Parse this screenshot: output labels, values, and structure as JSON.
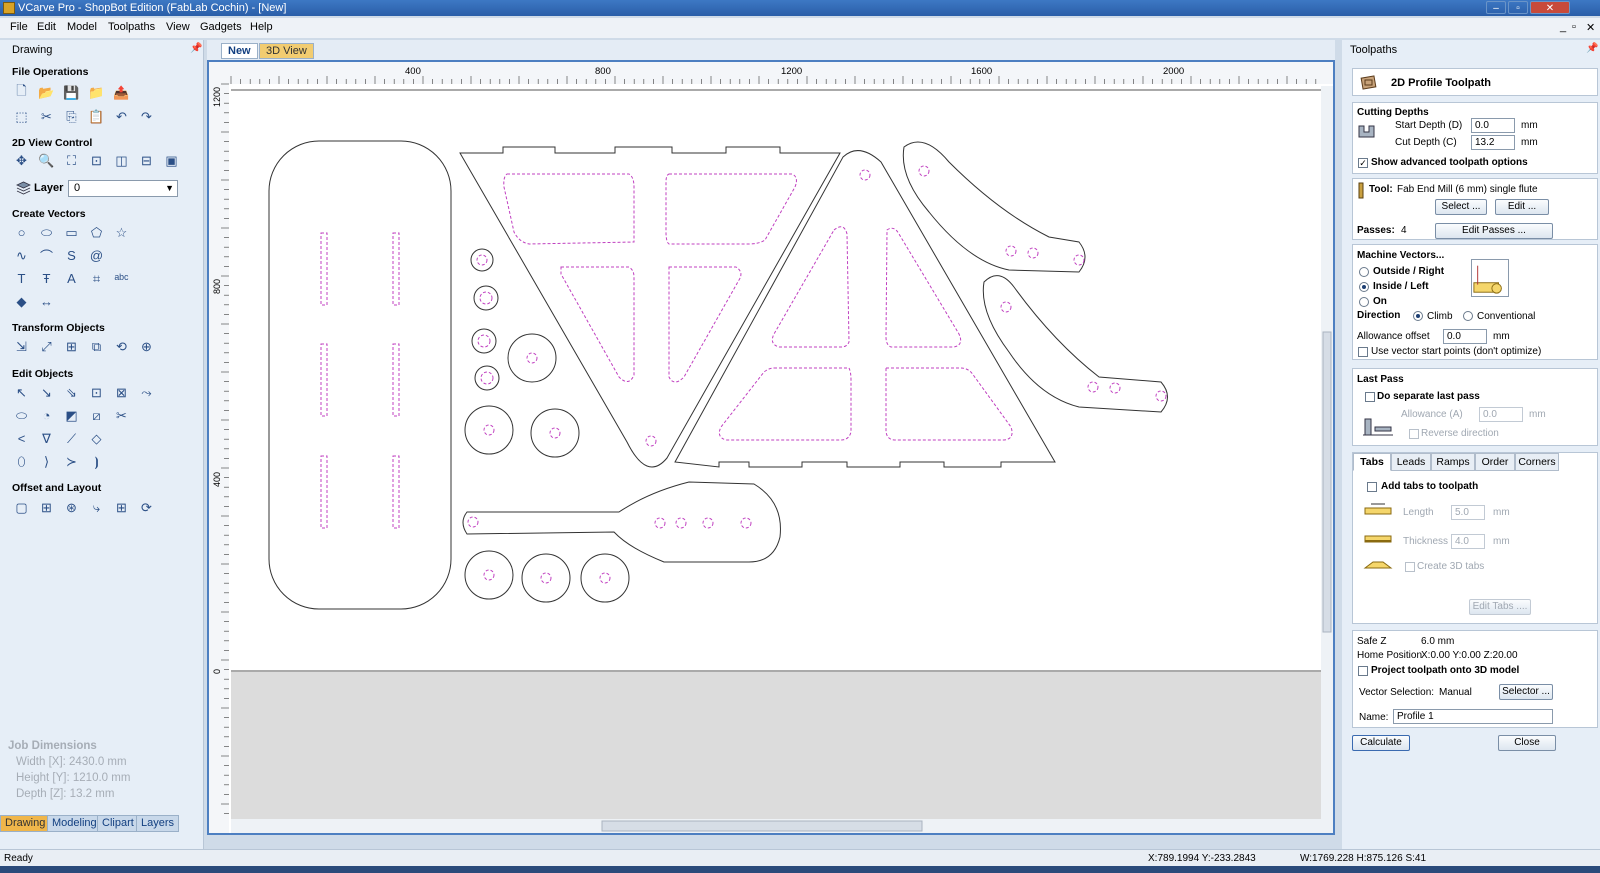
{
  "window": {
    "title": "VCarve Pro - ShopBot Edition (FabLab Cochin) - [New]",
    "min": "‒",
    "max": "▫",
    "close": "✕"
  },
  "menu": [
    "File",
    "Edit",
    "Model",
    "Toolpaths",
    "View",
    "Gadgets",
    "Help"
  ],
  "mdi_controls": [
    "_",
    "▫",
    "✕"
  ],
  "left_panel": {
    "title": "Drawing",
    "sections": [
      "File Operations",
      "2D View Control",
      "Create Vectors",
      "Transform Objects",
      "Edit Objects",
      "Offset and Layout"
    ],
    "layer_label": "Layer",
    "layer_value": "0",
    "job_dimensions": {
      "title": "Job Dimensions",
      "width": "Width  [X]: 2430.0 mm",
      "height": "Height [Y]: 1210.0 mm",
      "depth": "Depth  [Z]: 13.2 mm"
    },
    "tabs": [
      "Drawing",
      "Modeling",
      "Clipart",
      "Layers"
    ]
  },
  "view_tabs": {
    "new": "New",
    "view3d": "3D View"
  },
  "rulers": {
    "h_ticks": [
      "400",
      "800",
      "1200",
      "1600",
      "2000"
    ],
    "v_ticks": [
      "1200",
      "800",
      "400",
      "0"
    ]
  },
  "right_panel": {
    "title": "Toolpaths",
    "header": "2D Profile Toolpath",
    "cutting_depths": {
      "title": "Cutting Depths",
      "start_label": "Start Depth (D)",
      "start_value": "0.0",
      "cut_label": "Cut Depth (C)",
      "cut_value": "13.2",
      "unit": "mm",
      "show_advanced": "Show advanced toolpath options"
    },
    "tool": {
      "label": "Tool:",
      "name": "Fab End Mill (6 mm) single flute",
      "select_btn": "Select ...",
      "edit_btn": "Edit ...",
      "passes_label": "Passes:",
      "passes_value": "4",
      "edit_passes_btn": "Edit Passes ..."
    },
    "machine_vectors": {
      "title": "Machine Vectors...",
      "options": [
        "Outside / Right",
        "Inside / Left",
        "On"
      ],
      "selected": "Inside / Left",
      "direction_label": "Direction",
      "climb": "Climb",
      "conventional": "Conventional",
      "allowance_label": "Allowance offset",
      "allowance_value": "0.0",
      "unit": "mm",
      "use_start_points": "Use vector start points (don't optimize)"
    },
    "last_pass": {
      "title": "Last Pass",
      "separate": "Do separate last pass",
      "allowance_label": "Allowance (A)",
      "allowance_value": "0.0",
      "unit": "mm",
      "reverse": "Reverse direction"
    },
    "tabs_section": {
      "tabs": [
        "Tabs",
        "Leads",
        "Ramps",
        "Order",
        "Corners"
      ],
      "add_tabs": "Add tabs to toolpath",
      "length_label": "Length",
      "length_value": "5.0",
      "thickness_label": "Thickness",
      "thickness_value": "4.0",
      "unit": "mm",
      "create_3d": "Create 3D tabs",
      "edit_tabs_btn": "Edit Tabs ...."
    },
    "safe": {
      "safe_z_label": "Safe Z",
      "safe_z_value": "6.0 mm",
      "home_label": "Home Position",
      "home_value": "X:0.00 Y:0.00 Z:20.00",
      "project": "Project toolpath onto 3D model",
      "vector_sel_label": "Vector Selection:",
      "vector_sel_value": "Manual",
      "selector_btn": "Selector ...",
      "name_label": "Name:",
      "name_value": "Profile 1"
    },
    "calculate_btn": "Calculate",
    "close_btn": "Close"
  },
  "status": {
    "ready": "Ready",
    "coords": "X:789.1994 Y:-233.2843",
    "dims": "W:1769.228  H:875.126  S:41"
  },
  "colors": {
    "accent": "#4d7fc1",
    "pocket": "#c040c0",
    "outline": "#333333",
    "tab_active": "#f0b64a"
  }
}
